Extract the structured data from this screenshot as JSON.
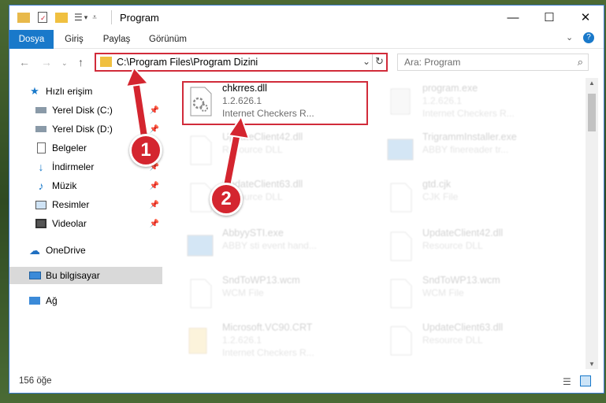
{
  "window": {
    "title": "Program"
  },
  "ribbon": {
    "tabs": [
      "Dosya",
      "Giriş",
      "Paylaş",
      "Görünüm"
    ]
  },
  "address": {
    "path": "C:\\Program Files\\Program Dizini"
  },
  "search": {
    "placeholder": "Ara: Program"
  },
  "sidebar": {
    "items": [
      {
        "label": "Hızlı erişim",
        "icon": "star-icon"
      },
      {
        "label": "Yerel Disk (C:)",
        "icon": "drive-icon",
        "pinned": true
      },
      {
        "label": "Yerel Disk (D:)",
        "icon": "drive-icon",
        "pinned": true
      },
      {
        "label": "Belgeler",
        "icon": "document-icon",
        "pinned": true
      },
      {
        "label": "İndirmeler",
        "icon": "download-icon",
        "pinned": true
      },
      {
        "label": "Müzik",
        "icon": "music-icon",
        "pinned": true
      },
      {
        "label": "Resimler",
        "icon": "pictures-icon",
        "pinned": true
      },
      {
        "label": "Videolar",
        "icon": "video-icon",
        "pinned": true
      },
      {
        "label": "OneDrive",
        "icon": "cloud-icon"
      },
      {
        "label": "Bu bilgisayar",
        "icon": "computer-icon"
      },
      {
        "label": "Ağ",
        "icon": "network-icon"
      }
    ]
  },
  "files": [
    {
      "name": "chkrres.dll",
      "line2": "1.2.626.1",
      "line3": "Internet Checkers R...",
      "highlighted": true
    },
    {
      "name": "program.exe",
      "line2": "1.2.626.1",
      "line3": "Internet Checkers R..."
    },
    {
      "name": "UpdateClient42.dll",
      "line2": "Resource DLL"
    },
    {
      "name": "TrigrammInstaller.exe",
      "line2": "ABBY finereader tr..."
    },
    {
      "name": "UpdateClient63.dll",
      "line2": "Resource DLL"
    },
    {
      "name": "gtd.cjk",
      "line2": "CJK File"
    },
    {
      "name": "AbbyySTI.exe",
      "line2": "ABBY sti event hand..."
    },
    {
      "name": "UpdateClient42.dll",
      "line2": "Resource DLL"
    },
    {
      "name": "SndToWP13.wcm",
      "line2": "WCM File"
    },
    {
      "name": "SndToWP13.wcm",
      "line2": "WCM File"
    },
    {
      "name": "Microsoft.VC90.CRT",
      "line2": "1.2.626.1",
      "line3": "Internet Checkers R..."
    },
    {
      "name": "UpdateClient63.dll",
      "line2": "Resource DLL"
    }
  ],
  "status": {
    "count": "156 öğe"
  },
  "annotations": {
    "one": "1",
    "two": "2"
  },
  "colors": {
    "accent": "#1979ca",
    "highlight": "#d12b3a"
  }
}
